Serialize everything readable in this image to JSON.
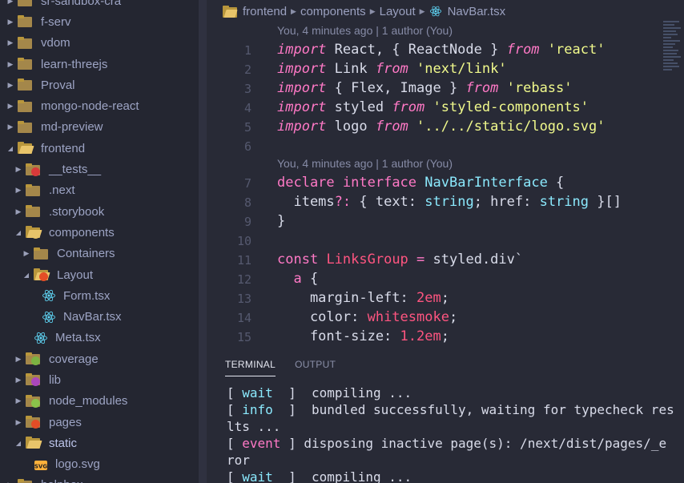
{
  "sidebar": {
    "items": [
      {
        "label": "sr-sandbox-cra",
        "type": "folder",
        "open": false,
        "expanded": false,
        "indent": 0,
        "badge": null
      },
      {
        "label": "f-serv",
        "type": "folder",
        "open": false,
        "expanded": false,
        "indent": 0,
        "badge": null
      },
      {
        "label": "vdom",
        "type": "folder",
        "open": false,
        "expanded": false,
        "indent": 0,
        "badge": null
      },
      {
        "label": "learn-threejs",
        "type": "folder",
        "open": false,
        "expanded": false,
        "indent": 0,
        "badge": null
      },
      {
        "label": "Proval",
        "type": "folder",
        "open": false,
        "expanded": false,
        "indent": 0,
        "badge": null
      },
      {
        "label": "mongo-node-react",
        "type": "folder",
        "open": false,
        "expanded": false,
        "indent": 0,
        "badge": null
      },
      {
        "label": "md-preview",
        "type": "folder",
        "open": false,
        "expanded": false,
        "indent": 0,
        "badge": null
      },
      {
        "label": "frontend",
        "type": "folder",
        "open": true,
        "expanded": true,
        "indent": 0,
        "badge": null
      },
      {
        "label": "__tests__",
        "type": "folder",
        "open": false,
        "expanded": false,
        "indent": 1,
        "badge": "#d83a3a"
      },
      {
        "label": ".next",
        "type": "folder",
        "open": false,
        "expanded": false,
        "indent": 1,
        "badge": null
      },
      {
        "label": ".storybook",
        "type": "folder",
        "open": false,
        "expanded": false,
        "indent": 1,
        "badge": null
      },
      {
        "label": "components",
        "type": "folder",
        "open": true,
        "expanded": true,
        "indent": 1,
        "badge": "#e8c46a"
      },
      {
        "label": "Containers",
        "type": "folder",
        "open": false,
        "expanded": false,
        "indent": 2,
        "badge": null
      },
      {
        "label": "Layout",
        "type": "folder",
        "open": true,
        "expanded": true,
        "indent": 2,
        "badge": "#e44d26"
      },
      {
        "label": "Form.tsx",
        "type": "react",
        "indent": 3
      },
      {
        "label": "NavBar.tsx",
        "type": "react",
        "indent": 3
      },
      {
        "label": "Meta.tsx",
        "type": "react",
        "indent": 2
      },
      {
        "label": "coverage",
        "type": "folder",
        "open": false,
        "expanded": false,
        "indent": 1,
        "badge": "#7cb342"
      },
      {
        "label": "lib",
        "type": "folder",
        "open": false,
        "expanded": false,
        "indent": 1,
        "badge": "#ab47bc"
      },
      {
        "label": "node_modules",
        "type": "folder",
        "open": false,
        "expanded": false,
        "indent": 1,
        "badge": "#8bc34a"
      },
      {
        "label": "pages",
        "type": "folder",
        "open": false,
        "expanded": false,
        "indent": 1,
        "badge": "#e44d26"
      },
      {
        "label": "static",
        "type": "folder",
        "open": true,
        "expanded": true,
        "indent": 1,
        "badge": null,
        "active": true
      },
      {
        "label": "logo.svg",
        "type": "svg",
        "indent": 2
      },
      {
        "label": "helpbox",
        "type": "folder",
        "open": false,
        "expanded": false,
        "indent": 0,
        "badge": null
      }
    ]
  },
  "breadcrumb": {
    "parts": [
      "frontend",
      "components",
      "Layout",
      "NavBar.tsx"
    ]
  },
  "editor": {
    "codelens": [
      {
        "text": "You, 4 minutes ago | 1 author (You)",
        "before_line": 1
      },
      {
        "text": "You, 4 minutes ago | 1 author (You)",
        "before_line": 7
      }
    ],
    "lines": [
      {
        "n": "1",
        "tokens": [
          [
            "kw",
            "import"
          ],
          [
            "id",
            " React, { ReactNode } "
          ],
          [
            "kw",
            "from"
          ],
          [
            "id",
            " "
          ],
          [
            "str",
            "'react'"
          ]
        ]
      },
      {
        "n": "2",
        "tokens": [
          [
            "kw",
            "import"
          ],
          [
            "id",
            " Link "
          ],
          [
            "kw",
            "from"
          ],
          [
            "id",
            " "
          ],
          [
            "str",
            "'next/link'"
          ]
        ]
      },
      {
        "n": "3",
        "tokens": [
          [
            "kw",
            "import"
          ],
          [
            "id",
            " { Flex, Image } "
          ],
          [
            "kw",
            "from"
          ],
          [
            "id",
            " "
          ],
          [
            "str",
            "'rebass'"
          ]
        ]
      },
      {
        "n": "4",
        "tokens": [
          [
            "kw",
            "import"
          ],
          [
            "id",
            " styled "
          ],
          [
            "kw",
            "from"
          ],
          [
            "id",
            " "
          ],
          [
            "str",
            "'styled-components'"
          ]
        ]
      },
      {
        "n": "5",
        "tokens": [
          [
            "kw",
            "import"
          ],
          [
            "id",
            " logo "
          ],
          [
            "kw",
            "from"
          ],
          [
            "id",
            " "
          ],
          [
            "str",
            "'../../static/logo.svg'"
          ]
        ]
      },
      {
        "n": "6",
        "tokens": []
      },
      {
        "n": "7",
        "tokens": [
          [
            "kw2",
            "declare"
          ],
          [
            "id",
            " "
          ],
          [
            "kw2",
            "interface"
          ],
          [
            "id",
            " "
          ],
          [
            "cls",
            "NavBarInterface"
          ],
          [
            "id",
            " {"
          ]
        ]
      },
      {
        "n": "8",
        "tokens": [
          [
            "id",
            "  items"
          ],
          [
            "kw2",
            "?:"
          ],
          [
            "id",
            " { text: "
          ],
          [
            "cls",
            "string"
          ],
          [
            "id",
            "; href: "
          ],
          [
            "cls",
            "string"
          ],
          [
            "id",
            " }[]"
          ]
        ]
      },
      {
        "n": "9",
        "tokens": [
          [
            "id",
            "}"
          ]
        ]
      },
      {
        "n": "10",
        "tokens": []
      },
      {
        "n": "11",
        "tokens": [
          [
            "kw2",
            "const"
          ],
          [
            "id",
            " "
          ],
          [
            "var",
            "LinksGroup"
          ],
          [
            "id",
            " "
          ],
          [
            "kw2",
            "="
          ],
          [
            "id",
            " styled.div`"
          ]
        ]
      },
      {
        "n": "12",
        "tokens": [
          [
            "id",
            "  "
          ],
          [
            "kw2",
            "a"
          ],
          [
            "id",
            " {"
          ]
        ]
      },
      {
        "n": "13",
        "tokens": [
          [
            "id",
            "    margin-left: "
          ],
          [
            "val",
            "2em"
          ],
          [
            "id",
            ";"
          ]
        ]
      },
      {
        "n": "14",
        "tokens": [
          [
            "id",
            "    color: "
          ],
          [
            "val",
            "whitesmoke"
          ],
          [
            "id",
            ";"
          ]
        ]
      },
      {
        "n": "15",
        "tokens": [
          [
            "id",
            "    font-size: "
          ],
          [
            "val",
            "1.2em"
          ],
          [
            "id",
            ";"
          ]
        ]
      }
    ]
  },
  "panel": {
    "tabs": [
      "TERMINAL",
      "OUTPUT"
    ],
    "active_tab": "TERMINAL",
    "terminal_lines": [
      [
        [
          "id",
          "[ "
        ],
        [
          "tw",
          "wait"
        ],
        [
          "id",
          "  ]  compiling ..."
        ]
      ],
      [
        [
          "id",
          "[ "
        ],
        [
          "tw",
          "info"
        ],
        [
          "id",
          "  ]  bundled successfully, waiting for typecheck res"
        ]
      ],
      [
        [
          "id",
          "lts ..."
        ]
      ],
      [
        [
          "id",
          "[ "
        ],
        [
          "kw2",
          "event"
        ],
        [
          "id",
          " ] disposing inactive page(s): /next/dist/pages/_e"
        ]
      ],
      [
        [
          "id",
          "ror"
        ]
      ],
      [
        [
          "id",
          "[ "
        ],
        [
          "tw",
          "wait"
        ],
        [
          "id",
          "  ]  compiling ..."
        ]
      ]
    ]
  },
  "colors": {
    "background": "#282a36",
    "sidebar": "#242631",
    "keyword": "#ff79c6",
    "string": "#f1fa8c",
    "type": "#8be9fd",
    "variable": "#ff5580",
    "folder": "#e8c46a"
  }
}
